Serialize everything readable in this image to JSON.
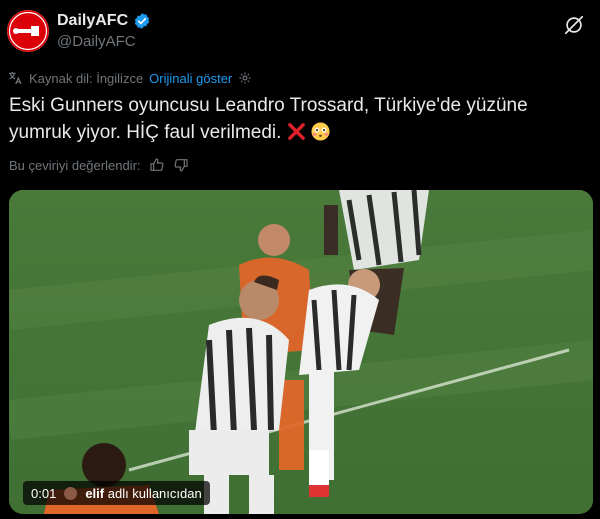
{
  "tweet": {
    "display_name": "DailyAFC",
    "handle": "@DailyAFC",
    "avatar_text": "Daily AFC",
    "translation_bar": {
      "source_label": "Kaynak dil: İngilizce",
      "show_original": "Orijinali göster"
    },
    "text": "Eski Gunners oyuncusu Leandro Trossard, Türkiye'de yüzüne yumruk yiyor. HİÇ faul verilmedi.",
    "emojis": [
      "cross-mark-icon",
      "flushed-face-icon"
    ],
    "rate_label": "Bu çeviriyi değerlendir:",
    "video": {
      "timestamp": "0:01",
      "tag_user": "elif",
      "tag_suffix": "adlı kullanıcıdan"
    }
  },
  "colors": {
    "background": "#000000",
    "text": "#e7e9ea",
    "secondary": "#71767b",
    "link": "#1d9bf0",
    "verified": "#1d9bf0",
    "brand_red": "#db0007"
  }
}
